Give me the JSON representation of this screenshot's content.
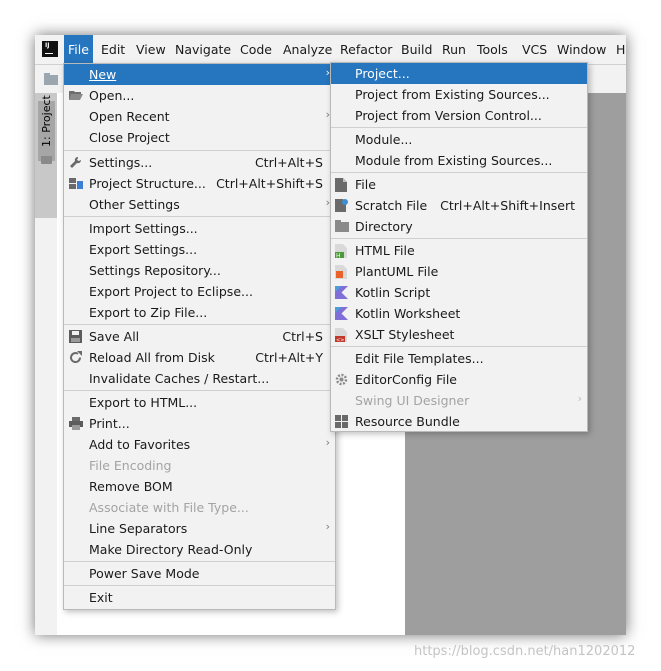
{
  "menubar": {
    "items": [
      "File",
      "Edit",
      "View",
      "Navigate",
      "Code",
      "Analyze",
      "Refactor",
      "Build",
      "Run",
      "Tools",
      "VCS",
      "Window",
      "H"
    ]
  },
  "sidebar": {
    "project_tab": "1: Project"
  },
  "file_menu": {
    "new": "New",
    "open": "Open...",
    "open_recent": "Open Recent",
    "close_project": "Close Project",
    "settings": "Settings...",
    "settings_sc": "Ctrl+Alt+S",
    "project_structure": "Project Structure...",
    "project_structure_sc": "Ctrl+Alt+Shift+S",
    "other_settings": "Other Settings",
    "import_settings": "Import Settings...",
    "export_settings": "Export Settings...",
    "settings_repository": "Settings Repository...",
    "export_eclipse": "Export Project to Eclipse...",
    "export_zip": "Export to Zip File...",
    "save_all": "Save All",
    "save_all_sc": "Ctrl+S",
    "reload_all": "Reload All from Disk",
    "reload_all_sc": "Ctrl+Alt+Y",
    "invalidate_caches": "Invalidate Caches / Restart...",
    "export_html": "Export to HTML...",
    "print": "Print...",
    "add_favorites": "Add to Favorites",
    "file_encoding": "File Encoding",
    "remove_bom": "Remove BOM",
    "associate_file_type": "Associate with File Type...",
    "line_separators": "Line Separators",
    "make_readonly": "Make Directory Read-Only",
    "power_save": "Power Save Mode",
    "exit": "Exit"
  },
  "new_menu": {
    "project": "Project...",
    "project_existing": "Project from Existing Sources...",
    "project_vcs": "Project from Version Control...",
    "module": "Module...",
    "module_existing": "Module from Existing Sources...",
    "file": "File",
    "scratch_file": "Scratch File",
    "scratch_file_sc": "Ctrl+Alt+Shift+Insert",
    "directory": "Directory",
    "html_file": "HTML File",
    "plantuml_file": "PlantUML File",
    "kotlin_script": "Kotlin Script",
    "kotlin_worksheet": "Kotlin Worksheet",
    "xslt_stylesheet": "XSLT Stylesheet",
    "edit_templates": "Edit File Templates...",
    "editorconfig_file": "EditorConfig File",
    "swing_ui_designer": "Swing UI Designer",
    "resource_bundle": "Resource Bundle"
  },
  "watermark": "https://blog.csdn.net/han1202012",
  "colors": {
    "selection": "#2675bf",
    "menu_bg": "#f2f2f2"
  }
}
